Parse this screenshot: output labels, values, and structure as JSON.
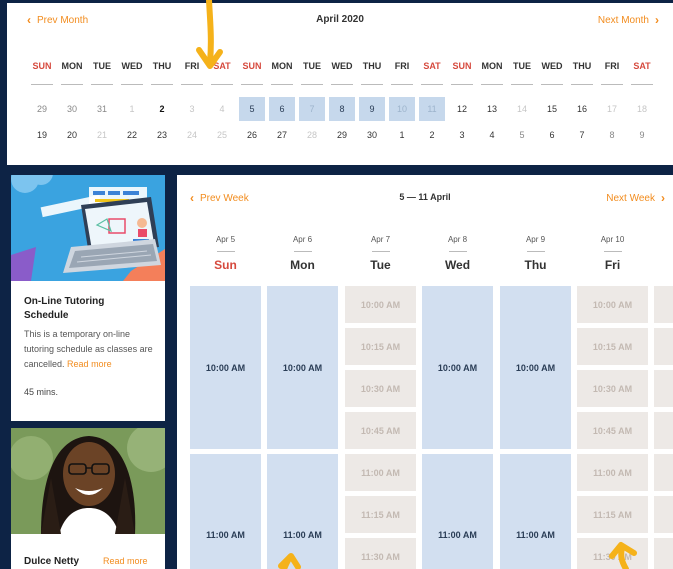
{
  "month": {
    "prev_label": "Prev Month",
    "next_label": "Next Month",
    "title": "April 2020",
    "weekdays": [
      "SUN",
      "MON",
      "TUE",
      "WED",
      "THU",
      "FRI",
      "SAT",
      "SUN",
      "MON",
      "TUE",
      "WED",
      "THU",
      "FRI",
      "SAT",
      "SUN",
      "MON",
      "TUE",
      "WED",
      "THU",
      "FRI",
      "SAT"
    ],
    "row1": [
      "29",
      "30",
      "31",
      "1",
      "2",
      "3",
      "4",
      "5",
      "6",
      "7",
      "8",
      "9",
      "10",
      "11",
      "12",
      "13",
      "14",
      "15",
      "16",
      "17",
      "18"
    ],
    "row2": [
      "19",
      "20",
      "21",
      "22",
      "23",
      "24",
      "25",
      "26",
      "27",
      "28",
      "29",
      "30",
      "1",
      "2",
      "3",
      "4",
      "5",
      "6",
      "7",
      "8",
      "9"
    ]
  },
  "cards": [
    {
      "title": "On-Line Tutoring Schedule",
      "description": "This is a temporary on-line tutoring schedule as classes are cancelled.",
      "read_more": "Read more",
      "duration": "45 mins."
    },
    {
      "title": "Dulce Netty",
      "read_more": "Read more"
    }
  ],
  "week": {
    "prev_label": "Prev Week",
    "next_label": "Next Week",
    "title": "5 — 11 April",
    "days": [
      {
        "date": "Apr 5",
        "name": "Sun"
      },
      {
        "date": "Apr 6",
        "name": "Mon"
      },
      {
        "date": "Apr 7",
        "name": "Tue"
      },
      {
        "date": "Apr 8",
        "name": "Wed"
      },
      {
        "date": "Apr 9",
        "name": "Thu"
      },
      {
        "date": "Apr 10",
        "name": "Fri"
      }
    ],
    "block_slots": [
      "10:00 AM",
      "11:00 AM"
    ],
    "small_slots": [
      "10:00 AM",
      "10:15 AM",
      "10:30 AM",
      "10:45 AM",
      "11:00 AM",
      "11:15 AM",
      "11:30 AM"
    ]
  },
  "colors": {
    "accent": "#f28c1e",
    "weekend": "#d64a3e",
    "available": "#d2dff0",
    "unavailable": "#ede9e6",
    "background": "#0d2345"
  }
}
